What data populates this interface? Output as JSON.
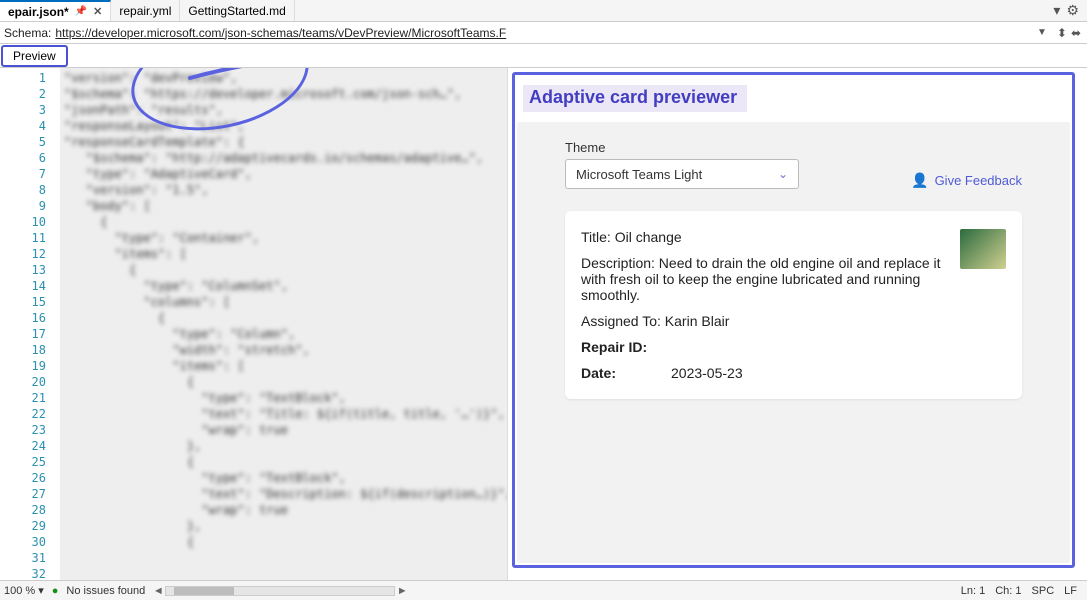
{
  "tabs": [
    {
      "label": "epair.json*",
      "active": true,
      "pinned": true,
      "closable": true
    },
    {
      "label": "repair.yml",
      "active": false
    },
    {
      "label": "GettingStarted.md",
      "active": false
    }
  ],
  "schema": {
    "label": "Schema:",
    "url": "https://developer.microsoft.com/json-schemas/teams/vDevPreview/MicrosoftTeams.F"
  },
  "preview_button": "Preview",
  "editor": {
    "line_count": 32,
    "code_lines": [
      "\"version\": \"devPreview\",",
      "\"$schema\": \"https://developer.microsoft.com/json-sch…\",",
      "\"jsonPath\": \"results\",",
      "\"responseLayout\": \"List\",",
      "\"responseCardTemplate\": {",
      "   \"$schema\": \"http://adaptivecards.io/schemas/adaptive…\",",
      "   \"type\": \"AdaptiveCard\",",
      "   \"version\": \"1.5\",",
      "   \"body\": [",
      "     {",
      "       \"type\": \"Container\",",
      "       \"items\": [",
      "         {",
      "           \"type\": \"ColumnSet\",",
      "           \"columns\": [",
      "             {",
      "               \"type\": \"Column\",",
      "               \"width\": \"stretch\",",
      "               \"items\": [",
      "                 {",
      "                   \"type\": \"TextBlock\",",
      "                   \"text\": \"Title: ${if(title, title, '…')}\",",
      "                   \"wrap\": true",
      "                 },",
      "                 {",
      "                   \"type\": \"TextBlock\",",
      "                   \"text\": \"Description: ${if(description…)}\",",
      "                   \"wrap\": true",
      "                 },",
      "                 {",
      "                 "
    ]
  },
  "previewer": {
    "title": "Adaptive card previewer",
    "theme_label": "Theme",
    "theme_value": "Microsoft Teams Light",
    "feedback": "Give Feedback",
    "card": {
      "title": "Title: Oil change",
      "description": "Description: Need to drain the old engine oil and replace it with fresh oil to keep the engine lubricated and running smoothly.",
      "assigned": "Assigned To: Karin Blair",
      "repair_id_label": "Repair ID:",
      "repair_id_value": "",
      "date_label": "Date:",
      "date_value": "2023-05-23"
    }
  },
  "status": {
    "zoom": "100 %",
    "issues": "No issues found",
    "ln": "Ln: 1",
    "ch": "Ch: 1",
    "spc": "SPC",
    "lf": "LF"
  }
}
